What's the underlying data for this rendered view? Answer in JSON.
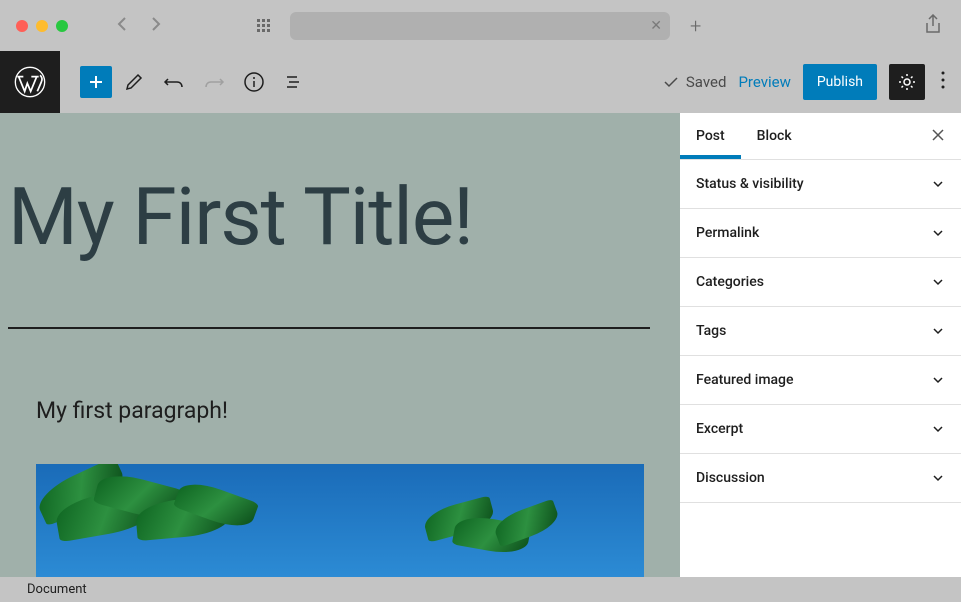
{
  "browser": {
    "nav_back": "‹",
    "nav_forward": "›"
  },
  "toolbar": {
    "saved_label": "Saved",
    "preview_label": "Preview",
    "publish_label": "Publish"
  },
  "editor": {
    "title": "My First Title!",
    "paragraph": "My first paragraph!"
  },
  "sidebar": {
    "tabs": [
      {
        "label": "Post",
        "active": true
      },
      {
        "label": "Block",
        "active": false
      }
    ],
    "panels": [
      {
        "title": "Status & visibility"
      },
      {
        "title": "Permalink"
      },
      {
        "title": "Categories"
      },
      {
        "title": "Tags"
      },
      {
        "title": "Featured image"
      },
      {
        "title": "Excerpt"
      },
      {
        "title": "Discussion"
      }
    ]
  },
  "bottom_bar": {
    "breadcrumb": "Document"
  }
}
